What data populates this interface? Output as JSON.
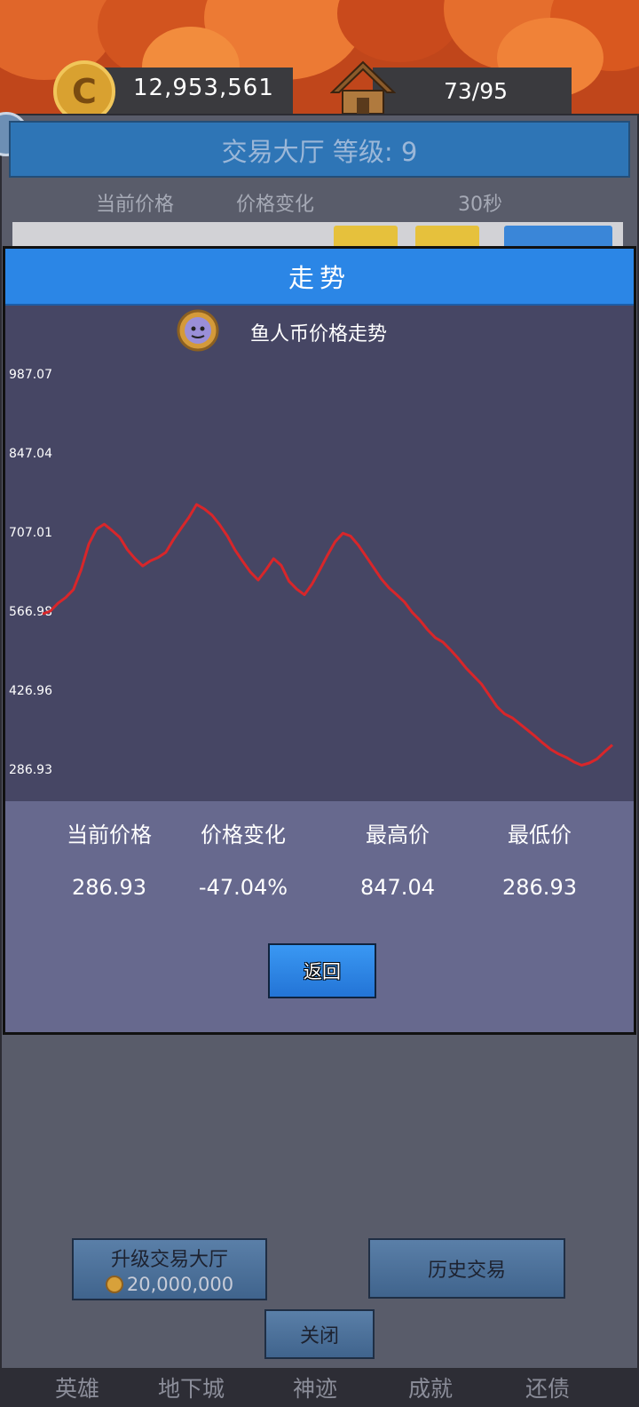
{
  "top_bar": {
    "coins": "12,953,561",
    "coin_icon_glyph": "C",
    "capacity": "73/95",
    "coin_icon": "gold-coin-icon",
    "house_icon": "hut-icon"
  },
  "hall": {
    "title": "交易大厅 等级: 9",
    "columns": [
      "当前价格",
      "价格变化",
      "30秒"
    ]
  },
  "modal": {
    "title": "走势",
    "chart_icon": "fishman-coin-icon",
    "stats": [
      {
        "label": "当前价格",
        "value": "286.93"
      },
      {
        "label": "价格变化",
        "value": "-47.04%"
      },
      {
        "label": "最高价",
        "value": "847.04"
      },
      {
        "label": "最低价",
        "value": "286.93"
      }
    ],
    "back_label": "返回"
  },
  "chart_data": {
    "type": "line",
    "title": "鱼人币价格走势",
    "yticks": [
      "987.07",
      "847.04",
      "707.01",
      "566.98",
      "426.96",
      "286.93"
    ],
    "ylim": [
      286.93,
      987.07
    ],
    "grid": false,
    "series": [
      {
        "color": "#d8262a",
        "values": [
          562,
          567,
          581,
          591,
          605,
          640,
          686,
          712,
          721,
          710,
          698,
          676,
          660,
          647,
          656,
          662,
          671,
          694,
          714,
          733,
          756,
          748,
          737,
          720,
          700,
          675,
          655,
          636,
          622,
          640,
          660,
          648,
          620,
          606,
          596,
          615,
          640,
          666,
          690,
          705,
          700,
          684,
          664,
          644,
          624,
          608,
          596,
          583,
          565,
          551,
          534,
          520,
          512,
          498,
          483,
          466,
          452,
          438,
          418,
          398,
          385,
          378,
          367,
          356,
          345,
          333,
          322,
          314,
          308,
          300,
          294,
          298,
          305,
          318,
          330
        ]
      }
    ]
  },
  "bottom": {
    "upgrade_label": "升级交易大厅",
    "upgrade_cost": "20,000,000",
    "history_label": "历史交易",
    "close_label": "关闭"
  },
  "nav": [
    "英雄",
    "地下城",
    "神迹",
    "成就",
    "还债"
  ]
}
